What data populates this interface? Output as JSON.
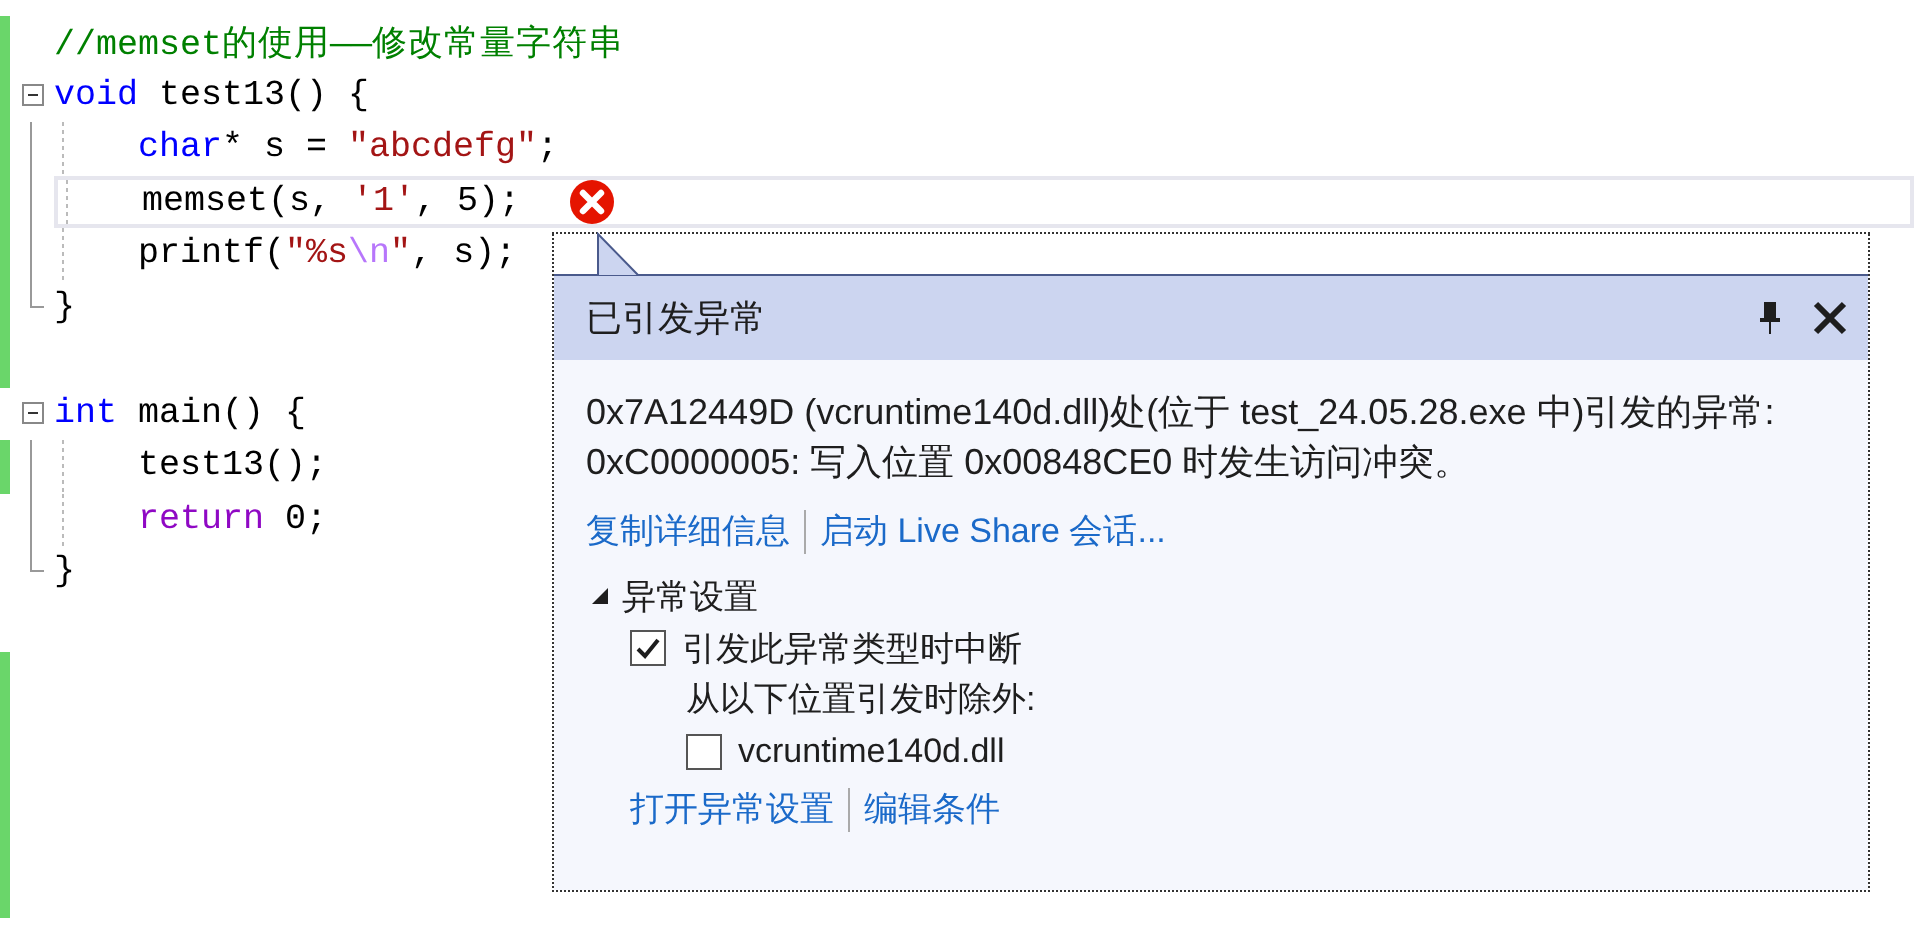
{
  "editor": {
    "lines": [
      {
        "modified": true,
        "tokens": [
          {
            "kind": "comment",
            "text": "//memset的使用——修改常量字符串"
          }
        ]
      },
      {
        "modified": true,
        "expanded": true,
        "tokens": [
          {
            "kind": "keyword",
            "text": "void"
          },
          {
            "kind": "plain",
            "text": " test13() {"
          }
        ],
        "children": [
          {
            "modified": true,
            "tokens": [
              {
                "kind": "keyword",
                "text": "char"
              },
              {
                "kind": "plain",
                "text": "* s = "
              },
              {
                "kind": "string",
                "text": "\"abcdefg\""
              },
              {
                "kind": "plain",
                "text": ";"
              }
            ]
          },
          {
            "modified": true,
            "current": true,
            "error": true,
            "tokens": [
              {
                "kind": "plain",
                "text": "memset(s, "
              },
              {
                "kind": "string",
                "text": "'1'"
              },
              {
                "kind": "plain",
                "text": ", 5);"
              }
            ]
          },
          {
            "modified": true,
            "tokens": [
              {
                "kind": "plain",
                "text": "printf("
              },
              {
                "kind": "string",
                "text": "\"%s"
              },
              {
                "kind": "escape",
                "text": "\\n"
              },
              {
                "kind": "string",
                "text": "\""
              },
              {
                "kind": "plain",
                "text": ", s);"
              }
            ]
          }
        ],
        "closing": {
          "modified": true,
          "tokens": [
            {
              "kind": "plain",
              "text": "}"
            }
          ]
        }
      },
      {
        "modified": true
      },
      {
        "modified": false,
        "expanded": true,
        "tokens": [
          {
            "kind": "keyword",
            "text": "int"
          },
          {
            "kind": "plain",
            "text": " main() {"
          }
        ],
        "children": [
          {
            "modified": true,
            "tokens": [
              {
                "kind": "plain",
                "text": "test13();"
              }
            ]
          },
          {
            "modified": false,
            "tokens": [
              {
                "kind": "control",
                "text": "return"
              },
              {
                "kind": "plain",
                "text": " 0;"
              }
            ]
          }
        ],
        "closing": {
          "modified": false,
          "tokens": [
            {
              "kind": "plain",
              "text": "}"
            }
          ]
        }
      },
      {
        "modified": false
      },
      {
        "modified": true
      },
      {
        "modified": true
      },
      {
        "modified": true
      },
      {
        "modified": true
      },
      {
        "modified": true
      }
    ]
  },
  "exception_popup": {
    "title": "已引发异常",
    "message": "0x7A12449D (vcruntime140d.dll)处(位于 test_24.05.28.exe 中)引发的异常: 0xC0000005: 写入位置 0x00848CE0 时发生访问冲突。",
    "links": [
      "复制详细信息",
      "启动 Live Share 会话..."
    ],
    "settings": {
      "title": "异常设置",
      "expanded": true,
      "items": [
        {
          "kind": "checkbox",
          "label": "引发此异常类型时中断",
          "checked": true
        },
        {
          "kind": "text",
          "label": "从以下位置引发时除外:"
        },
        {
          "kind": "checkbox",
          "label": "vcruntime140d.dll",
          "checked": false,
          "indented": true
        }
      ],
      "links": [
        "打开异常设置",
        "编辑条件"
      ]
    }
  }
}
